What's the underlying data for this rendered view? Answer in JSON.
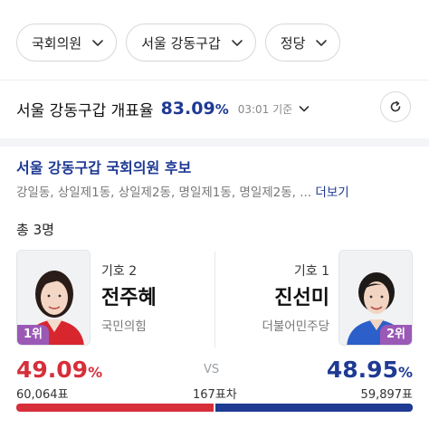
{
  "filters": [
    {
      "label": "국회의원"
    },
    {
      "label": "서울 강동구갑"
    },
    {
      "label": "정당"
    }
  ],
  "turnout": {
    "label": "서울 강동구갑 개표율",
    "value": "83.09",
    "unit": "%",
    "time": "03:01 기준"
  },
  "section": {
    "title": "서울 강동구갑 국회의원 후보",
    "areas": "강일동, 상일제1동, 상일제2동, 명일제1동, 명일제2동, ...",
    "more_label": "더보기"
  },
  "total": "총 3명",
  "candidates": [
    {
      "number_label": "기호 2",
      "name": "전주혜",
      "party": "국민의힘",
      "rank": "1위",
      "percent": "49.09",
      "percent_unit": "%",
      "votes": "60,064표",
      "share": 0.5006,
      "color": "#d62f3a"
    },
    {
      "number_label": "기호 1",
      "name": "진선미",
      "party": "더불어민주당",
      "rank": "2위",
      "percent": "48.95",
      "percent_unit": "%",
      "votes": "59,897표",
      "share": 0.4994,
      "color": "#1f3a93"
    }
  ],
  "vs_label": "VS",
  "difference": "167표차",
  "icons": {
    "chevron": "chevron-down-icon",
    "refresh": "refresh-icon"
  }
}
